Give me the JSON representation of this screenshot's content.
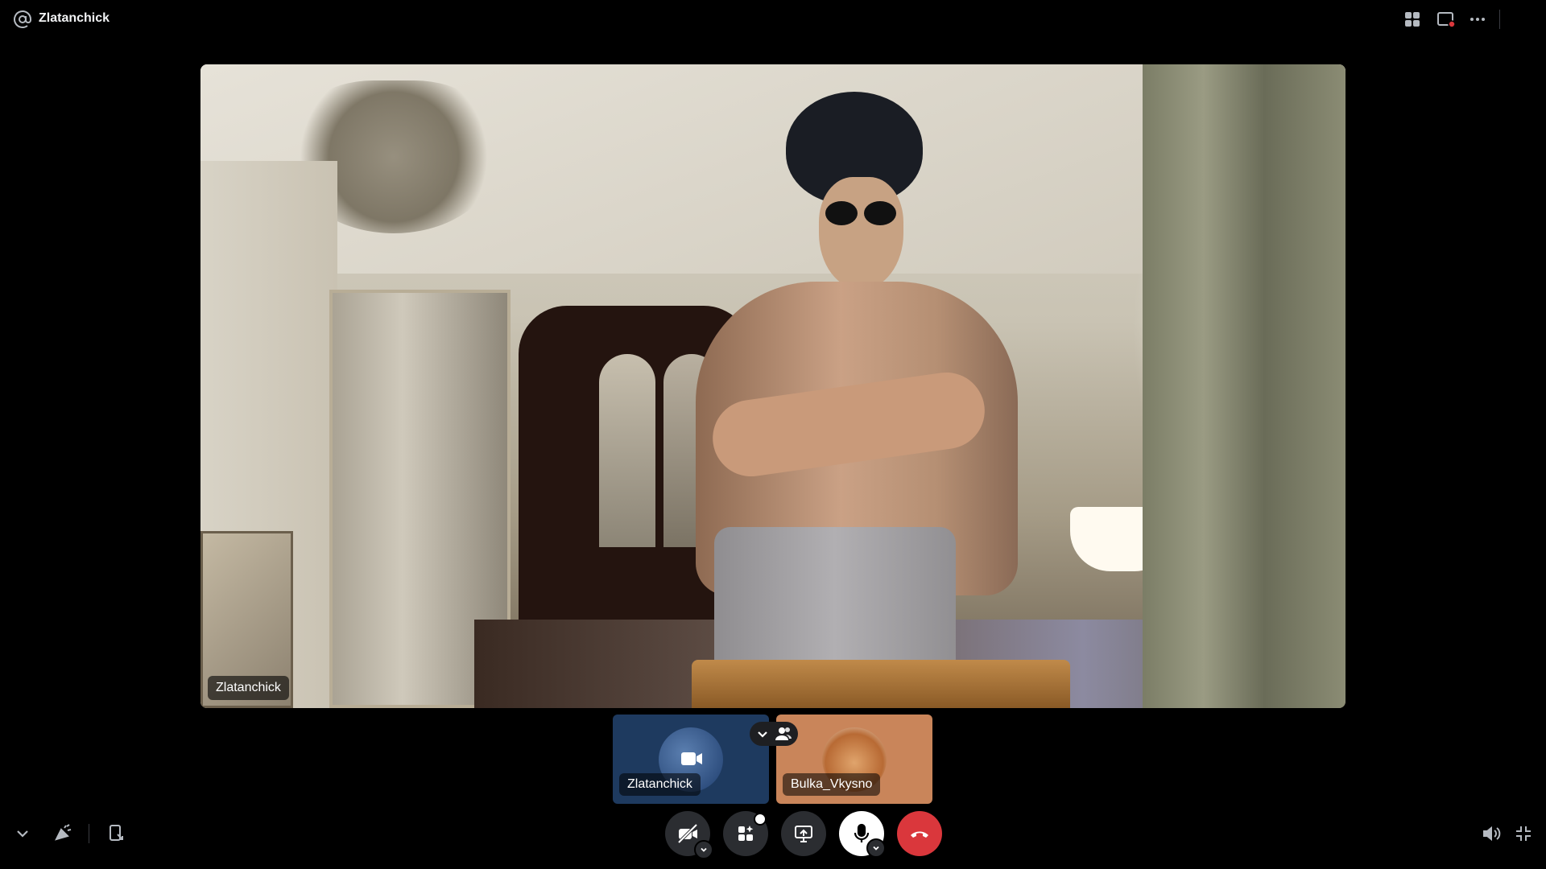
{
  "header": {
    "title": "Zlatanchick",
    "at_icon": "at-icon",
    "buttons": [
      "grid-layout-icon",
      "popout-window-icon",
      "more-options-icon"
    ]
  },
  "main_video": {
    "participant_label": "Zlatanchick"
  },
  "tiles": [
    {
      "name": "Zlatanchick",
      "status_icon": "video-camera-icon"
    },
    {
      "name": "Bulka_Vkysno"
    }
  ],
  "tile_overlay": {
    "icons": [
      "chevron-down-icon",
      "people-icon"
    ]
  },
  "controls": {
    "left": [
      "chevron-down-icon",
      "soundboard-icon",
      "activity-device-icon"
    ],
    "center": [
      "camera-off-icon",
      "activities-icon",
      "screen-share-icon",
      "microphone-icon",
      "hang-up-icon"
    ],
    "right": [
      "volume-icon",
      "exit-fullscreen-icon"
    ]
  },
  "colors": {
    "background": "#000000",
    "control_dark": "#2b2d31",
    "end_call": "#da373c",
    "tile_1": "#1e3a5f",
    "tile_2": "#c9855a"
  }
}
